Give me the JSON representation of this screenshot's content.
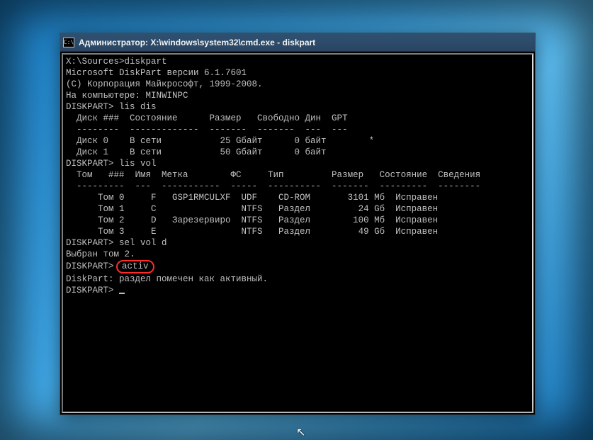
{
  "window": {
    "title": "Администратор: X:\\windows\\system32\\cmd.exe - diskpart",
    "sys_icon_label": "C:\\"
  },
  "c": {
    "l0": "X:\\Sources>diskpart",
    "l1": "",
    "l2": "Microsoft DiskPart версии 6.1.7601",
    "l3": "(C) Корпорация Майкрософт, 1999-2008.",
    "l4": "На компьютере: MINWINPC",
    "l5": "",
    "l6": "DISKPART> lis dis",
    "l7": "",
    "l8": "  Диск ###  Состояние      Размер   Свободно Дин  GPT",
    "l9": "  --------  -------------  -------  -------  ---  ---",
    "l10": "  Диск 0    В сети           25 Gбайт      0 байт        *",
    "l11": "  Диск 1    В сети           50 Gбайт      0 байт",
    "l12": "",
    "l13": "DISKPART> lis vol",
    "l14": "",
    "l15": "  Том   ###  Имя  Метка        ФС     Тип         Размер   Состояние  Сведения",
    "l16": "  ---------  ---  -----------  -----  ----------  -------  ---------  --------",
    "l17": "      Том 0     F   GSP1RMCULXF  UDF    CD-ROM       3101 Mб  Исправен",
    "l18": "      Том 1     C                NTFS   Раздел         24 Gб  Исправен",
    "l19": "      Том 2     D   Зарезервиро  NTFS   Раздел        100 Mб  Исправен",
    "l20": "      Том 3     E                NTFS   Раздел         49 Gб  Исправен",
    "l21": "",
    "l22": "DISKPART> sel vol d",
    "l23": "",
    "l24": "Выбран том 2.",
    "l25": "",
    "l26a": "DISKPART>",
    "l26b": "activ",
    "l27": "",
    "l28": "DiskPart: раздел помечен как активный.",
    "l29": "",
    "l30": "DISKPART> "
  }
}
